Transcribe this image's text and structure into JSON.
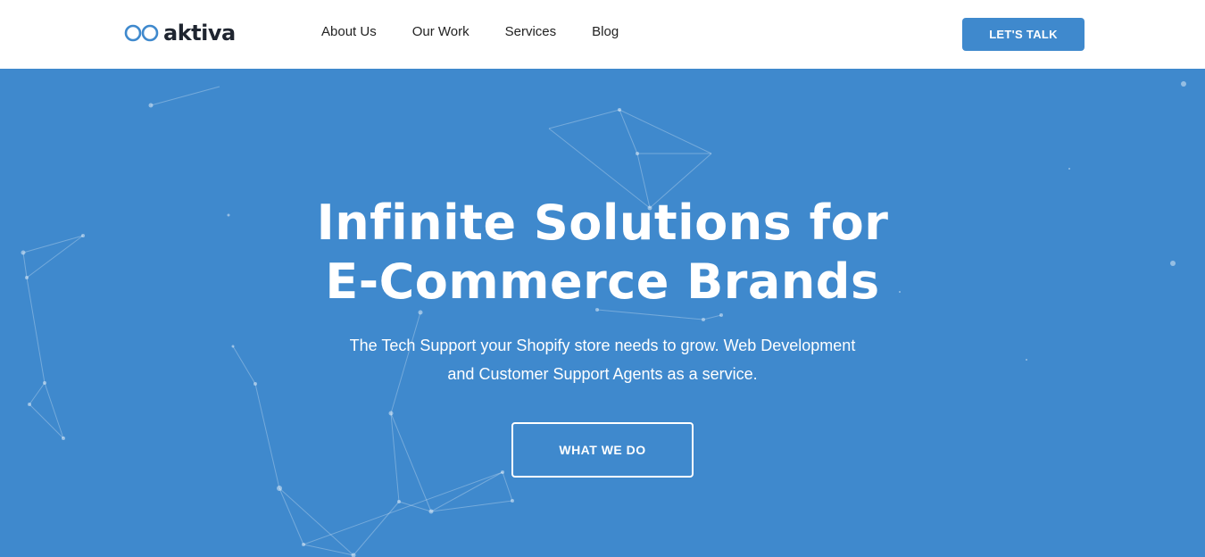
{
  "header": {
    "logo_text": "aktiva",
    "nav": [
      "About Us",
      "Our Work",
      "Services",
      "Blog"
    ],
    "cta_label": "LET'S TALK"
  },
  "hero": {
    "title_line1": "Infinite Solutions for",
    "title_line2": "E-Commerce Brands",
    "subtitle_line1": "The Tech Support your Shopify store needs to grow. Web Development",
    "subtitle_line2": "and Customer Support Agents as a service.",
    "button_label": "WHAT WE DO"
  },
  "colors": {
    "accent": "#3f89cd",
    "logo_infinity": "#3f89cd",
    "logo_text": "#1f2530"
  },
  "icons": {
    "logo": "infinity-icon"
  }
}
